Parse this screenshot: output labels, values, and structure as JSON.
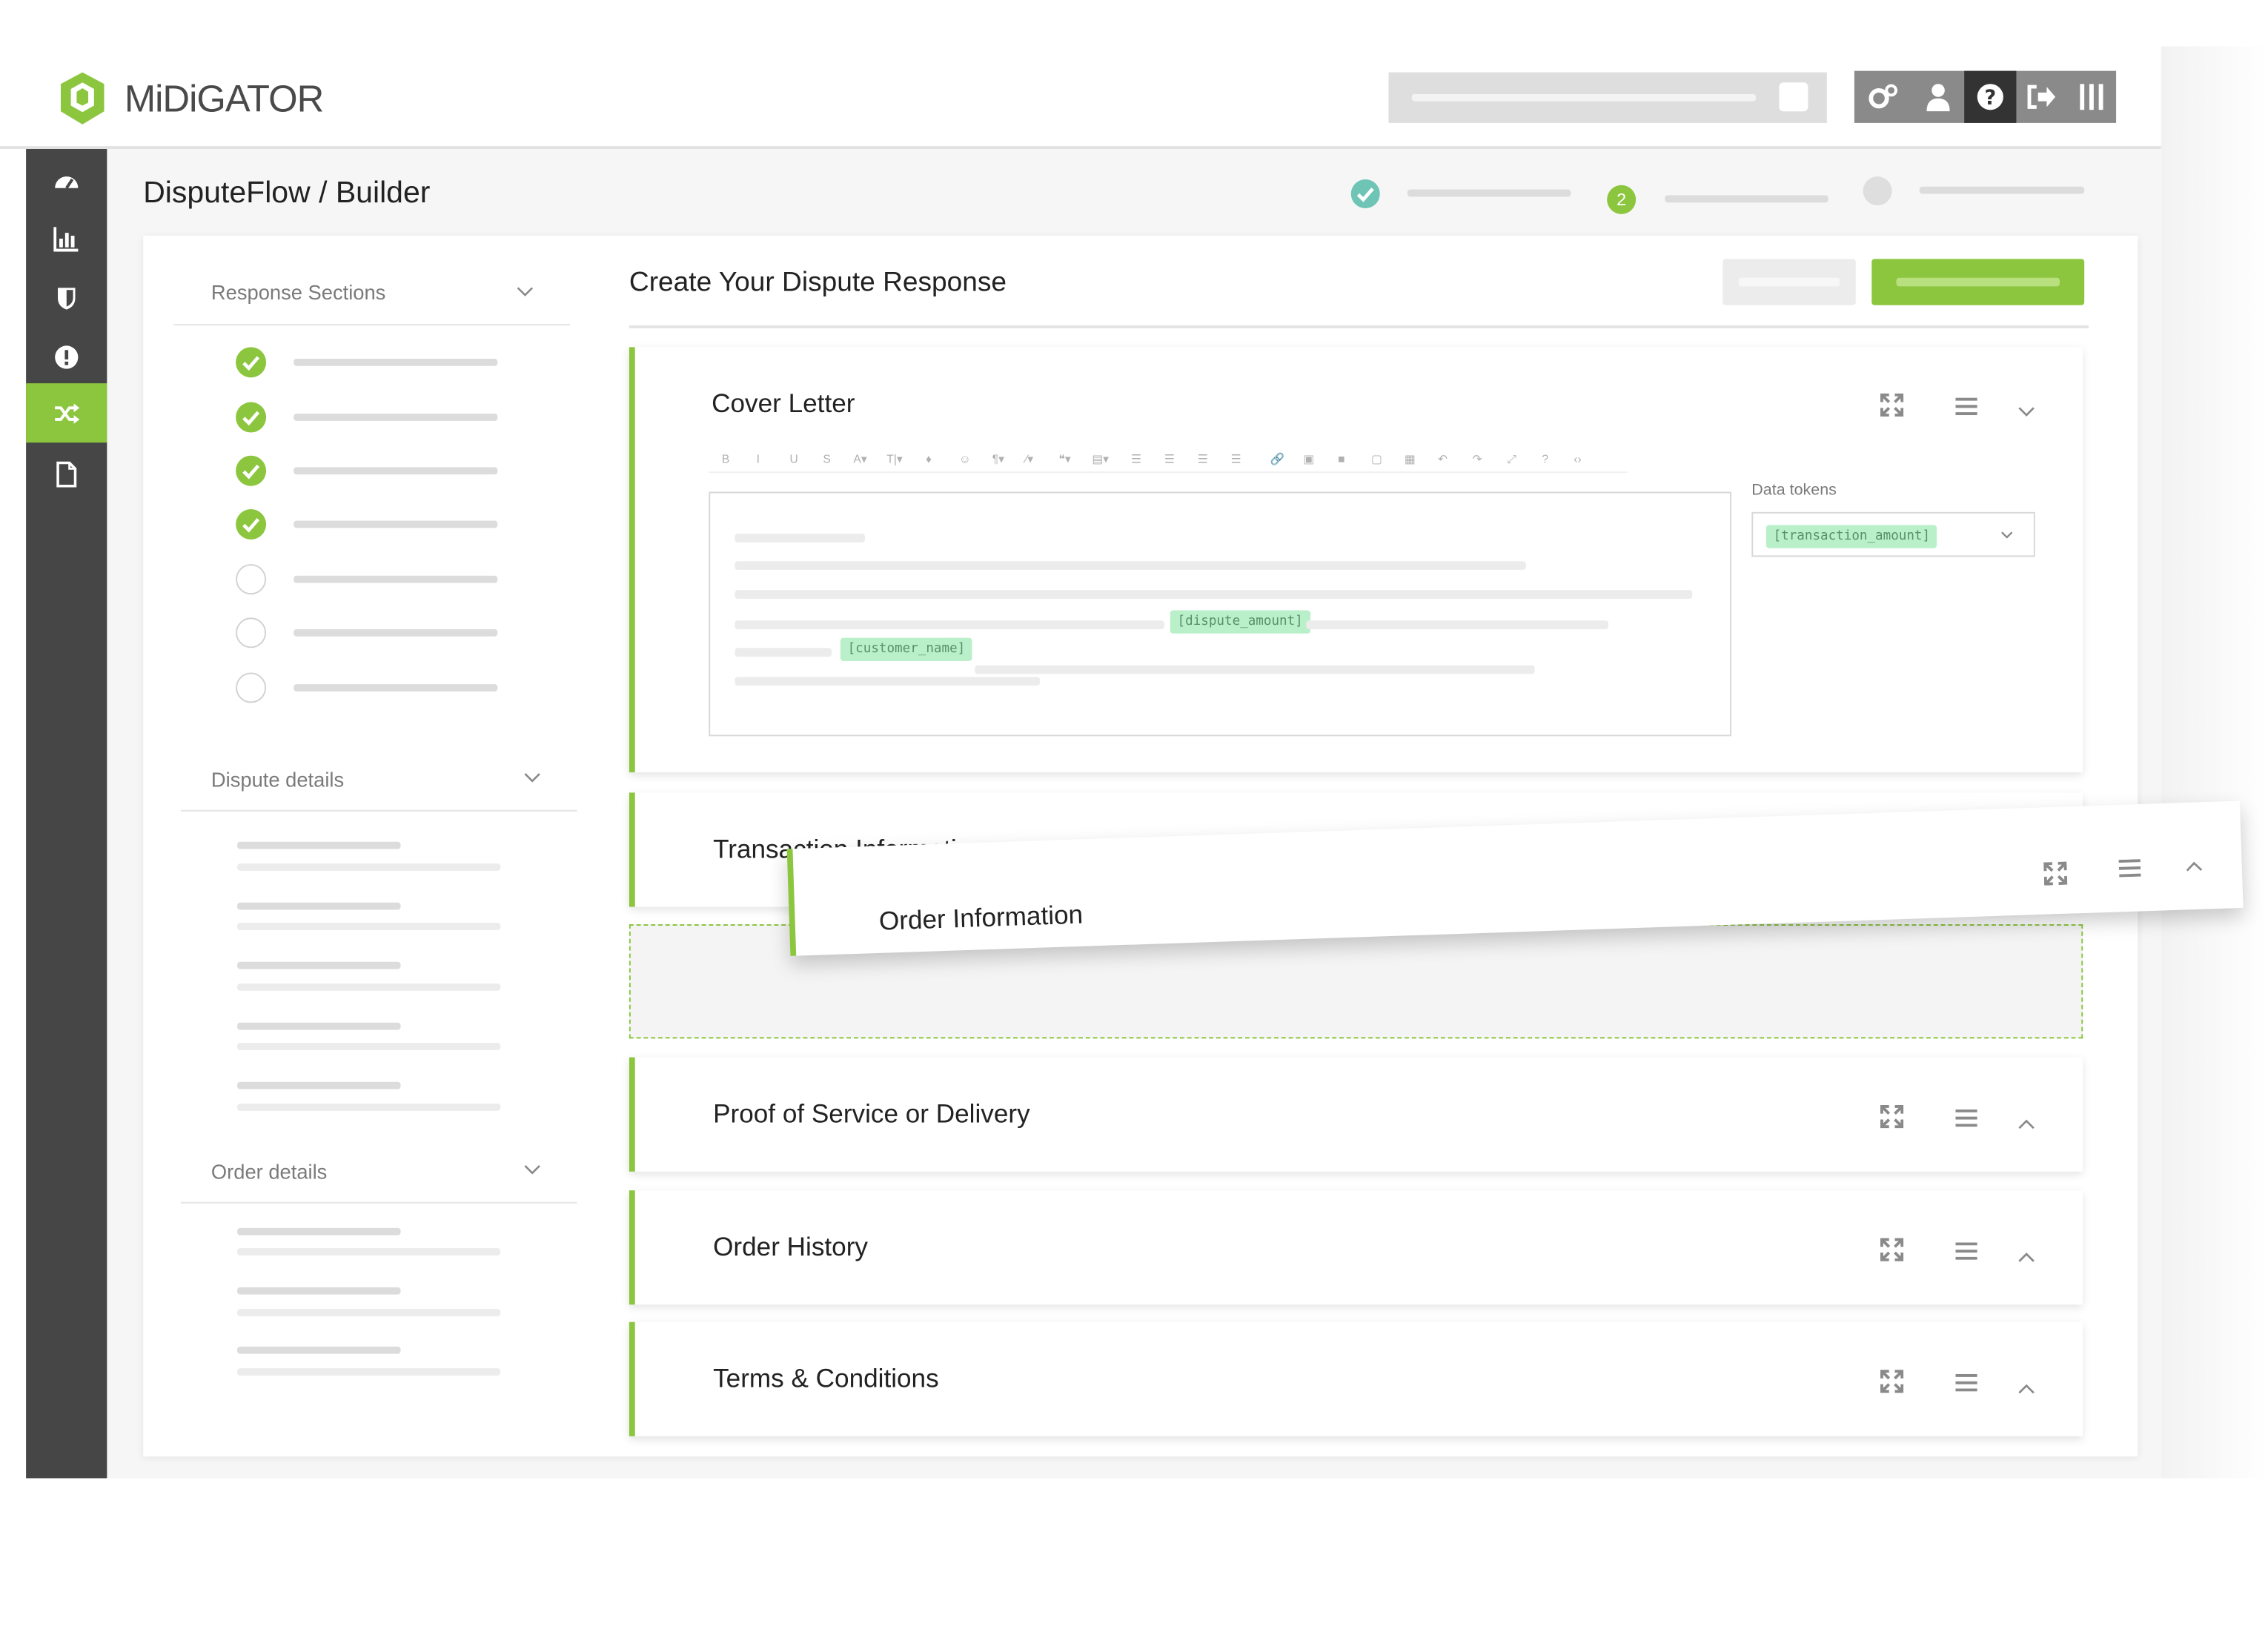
{
  "brand": {
    "name": "MiDiGATOR",
    "accent": "#8cc63f",
    "dark": "#464646"
  },
  "header": {
    "search_placeholder": "",
    "icons": [
      "gears-icon",
      "user-icon",
      "help-icon",
      "logout-icon",
      "columns-icon"
    ]
  },
  "sidebar": {
    "items": [
      "dashboard-icon",
      "chart-icon",
      "shield-icon",
      "alert-icon",
      "shuffle-icon",
      "document-icon"
    ],
    "active_index": 4
  },
  "page": {
    "title": "DisputeFlow / Builder"
  },
  "stepper": {
    "steps": [
      {
        "state": "done"
      },
      {
        "state": "active",
        "label": "2"
      },
      {
        "state": "todo"
      }
    ]
  },
  "left_panel": {
    "response_sections": {
      "title": "Response Sections",
      "checked": [
        true,
        true,
        true,
        true,
        false,
        false,
        false
      ]
    },
    "dispute_details": {
      "title": "Dispute details"
    },
    "order_details": {
      "title": "Order details"
    }
  },
  "main": {
    "title": "Create Your Dispute Response",
    "cover_letter": {
      "title": "Cover Letter",
      "tokens": {
        "dispute_amount": "[dispute_amount]",
        "customer_name": "[customer_name]"
      },
      "data_tokens_label": "Data tokens",
      "data_tokens_value": "[transaction_amount]",
      "toolbar": [
        "B",
        "I",
        "U",
        "S",
        "A▾",
        "T|▾",
        "♦",
        "☺",
        "¶▾",
        "⁄▾",
        "❝▾",
        "▤▾",
        "☰",
        "☰",
        "☰",
        "☰",
        "🔗",
        "▣",
        "■",
        "▢",
        "▦",
        "↶",
        "↷",
        "⤢",
        "?",
        "‹›"
      ]
    },
    "sections": [
      {
        "title": "Transaction Information"
      },
      {
        "title": "Order Information"
      },
      {
        "title": "Proof of Service or Delivery"
      },
      {
        "title": "Order History"
      },
      {
        "title": "Terms & Conditions"
      }
    ]
  }
}
